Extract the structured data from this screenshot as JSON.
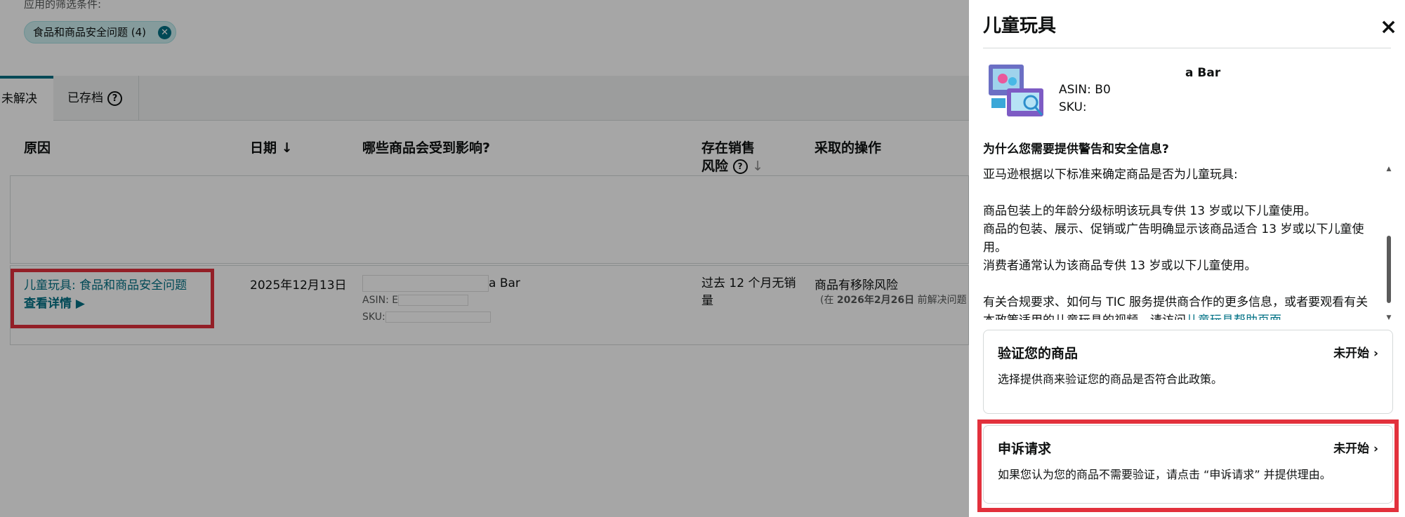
{
  "filters": {
    "label": "应用的筛选条件:",
    "chip_label": "食品和商品安全问题 (4)"
  },
  "tabs": {
    "unresolved": "未解决",
    "archived": "已存档"
  },
  "table": {
    "headers": {
      "reason": "原因",
      "date": "日期",
      "affected": "哪些商品会受到影响?",
      "risk_line1": "存在销售",
      "risk_line2": "风险",
      "action": "采取的操作"
    },
    "row": {
      "reason": "儿童玩具: 食品和商品安全问题",
      "details": "查看详情 ▶",
      "date": "2025年12月13日",
      "product_suffix": "a Bar",
      "asin_label": "ASIN:",
      "asin_value": "E",
      "sku_label": "SKU:",
      "risk": "过去 12 个月无销量",
      "action": "商品有移除风险",
      "action_sub_prefix": "(在 ",
      "action_sub_date": "2026年2月26日",
      "action_sub_suffix": " 前解决问题"
    }
  },
  "panel": {
    "title": "儿童玩具",
    "close": "×",
    "product": {
      "name_suffix": "a Bar",
      "asin": "ASIN: B0",
      "sku": "SKU:"
    },
    "why_title": "为什么您需要提供警告和安全信息?",
    "body": {
      "intro": "亚马逊根据以下标准来确定商品是否为儿童玩具:",
      "criterion1": "商品包装上的年龄分级标明该玩具专供 13 岁或以下儿童使用。",
      "criterion2": "商品的包装、展示、促销或广告明确显示该商品适合 13 岁或以下儿童使用。",
      "criterion3": "消费者通常认为该商品专供 13 岁或以下儿童使用。",
      "more_info": "有关合规要求、如何与 TIC 服务提供商合作的更多信息，或者要观看有关本政策适用的儿童玩具的视频，请访问",
      "help_link": "儿童玩具帮助页面"
    },
    "verify_card": {
      "title": "验证您的商品",
      "status": "未开始",
      "description": "选择提供商来验证您的商品是否符合此政策。"
    },
    "appeal_card": {
      "title": "申诉请求",
      "status": "未开始",
      "description": "如果您认为您的商品不需要验证，请点击 “申诉请求” 并提供理由。"
    }
  },
  "colors": {
    "link": "#007185",
    "highlight": "#e2313c",
    "chip_bg": "#cdeff0"
  }
}
